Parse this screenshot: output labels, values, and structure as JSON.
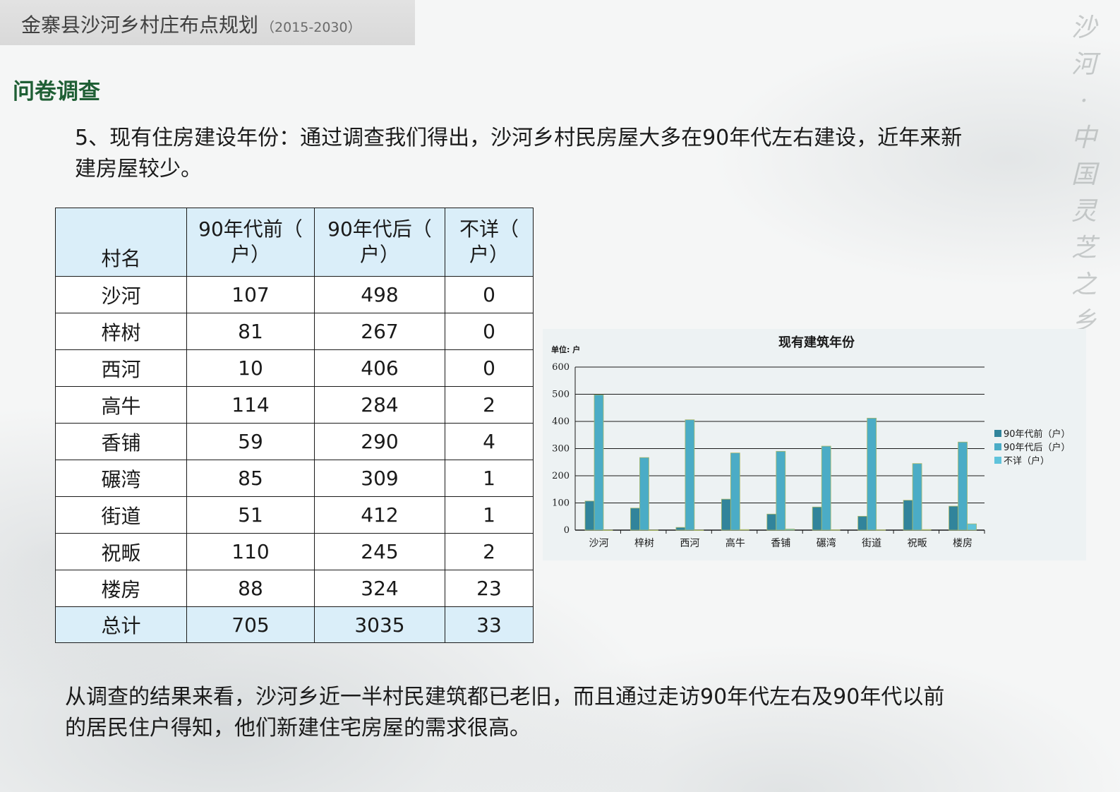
{
  "header": {
    "title": "金寨县沙河乡村庄布点规划",
    "years": "（2015-2030）"
  },
  "section_title": "问卷调查",
  "intro_text": "5、现有住房建设年份：通过调查我们得出，沙河乡村民房屋大多在90年代左右建设，近年来新\n建房屋较少。",
  "conclusion_text": "从调查的结果来看，沙河乡近一半村民建筑都已老旧，而且通过走访90年代左右及90年代以前\n的居民住户得知，他们新建住宅房屋的需求很高。",
  "side_chars": [
    "沙",
    "河",
    "·",
    "中",
    "国",
    "灵",
    "芝",
    "之",
    "乡"
  ],
  "table": {
    "headers": [
      "村名",
      "90年代前（\n户）",
      "90年代后（\n户）",
      "不详（\n户）"
    ],
    "rows": [
      [
        "沙河",
        "107",
        "498",
        "0"
      ],
      [
        "梓树",
        "81",
        "267",
        "0"
      ],
      [
        "西河",
        "10",
        "406",
        "0"
      ],
      [
        "高牛",
        "114",
        "284",
        "2"
      ],
      [
        "香铺",
        "59",
        "290",
        "4"
      ],
      [
        "碾湾",
        "85",
        "309",
        "1"
      ],
      [
        "街道",
        "51",
        "412",
        "1"
      ],
      [
        "祝畈",
        "110",
        "245",
        "2"
      ],
      [
        "楼房",
        "88",
        "324",
        "23"
      ]
    ],
    "total": [
      "总计",
      "705",
      "3035",
      "33"
    ]
  },
  "chart_data": {
    "type": "bar",
    "title": "现有建筑年份",
    "unit_label": "单位: 户",
    "categories": [
      "沙河",
      "梓树",
      "西河",
      "高牛",
      "香铺",
      "碾湾",
      "街道",
      "祝畈",
      "楼房"
    ],
    "series": [
      {
        "name": "90年代前（户）",
        "values": [
          107,
          81,
          10,
          114,
          59,
          85,
          51,
          110,
          88
        ],
        "color": "#31849b"
      },
      {
        "name": "90年代后（户）",
        "values": [
          498,
          267,
          406,
          284,
          290,
          309,
          412,
          245,
          324
        ],
        "color": "#4bacc6"
      },
      {
        "name": "不详（户）",
        "values": [
          0,
          0,
          0,
          2,
          4,
          1,
          1,
          2,
          23
        ],
        "color": "#5fc3db"
      }
    ],
    "ylim": [
      0,
      600
    ],
    "yticks": [
      0,
      100,
      200,
      300,
      400,
      500,
      600
    ],
    "grid": true,
    "legend_position": "right"
  }
}
